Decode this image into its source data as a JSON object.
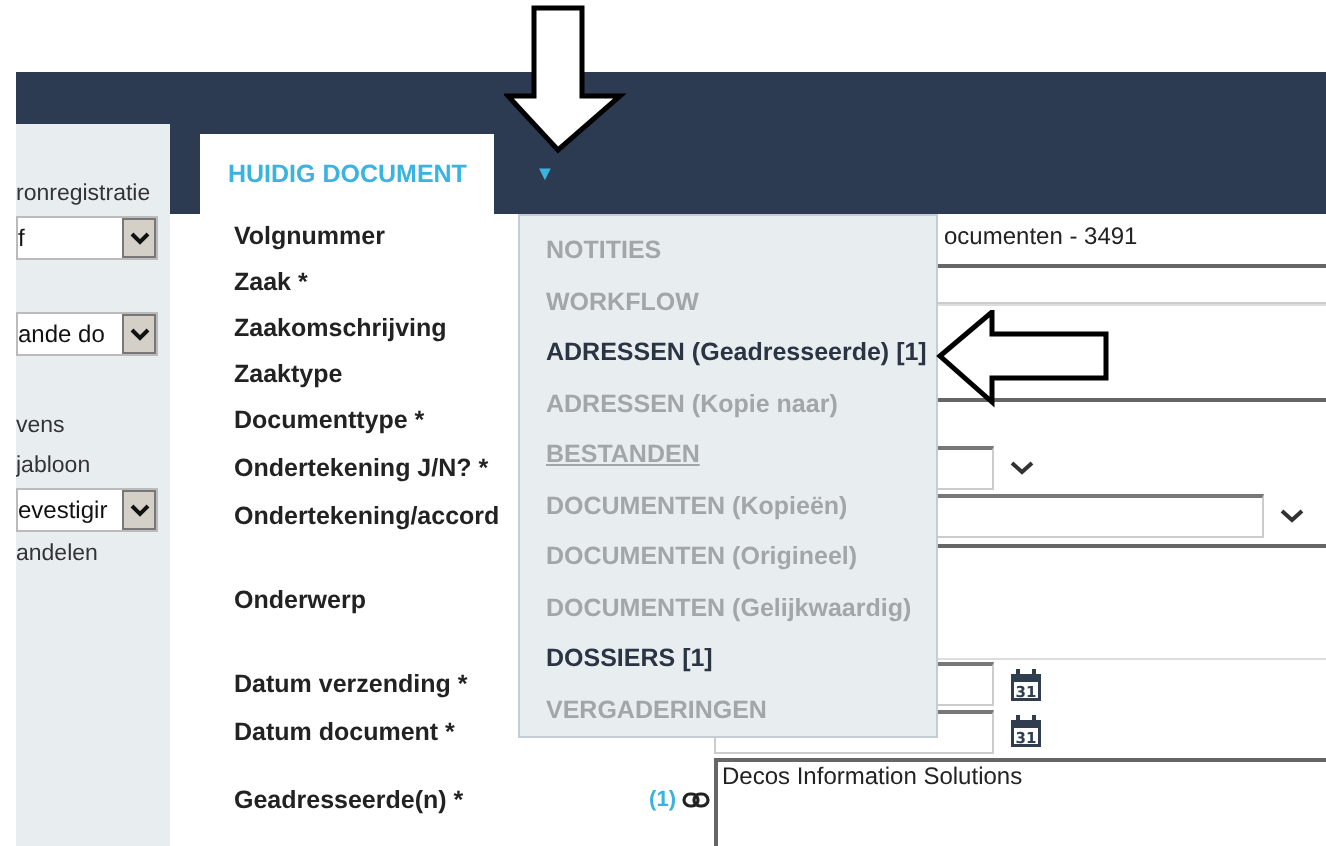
{
  "sidebar": {
    "items": [
      {
        "kind": "text",
        "text": "ronregistratie"
      },
      {
        "kind": "select",
        "value": "f"
      },
      {
        "kind": "gap"
      },
      {
        "kind": "select",
        "value": "ande do"
      },
      {
        "kind": "gap"
      },
      {
        "kind": "text",
        "text": "vens"
      },
      {
        "kind": "text",
        "text": "jabloon"
      },
      {
        "kind": "select",
        "value": "evestigir"
      },
      {
        "kind": "text",
        "text": "andelen"
      }
    ]
  },
  "tabs": [
    {
      "label": "HUIDIG DOCUMENT",
      "selected": true
    }
  ],
  "tab_menu_toggle": "▼",
  "form": {
    "fields": [
      {
        "label": "Volgnummer",
        "kind": "text",
        "value": "ocumenten - 3491"
      },
      {
        "label": "Zaak *",
        "kind": "input"
      },
      {
        "label": "Zaakomschrijving",
        "kind": "textarea"
      },
      {
        "label": "Zaaktype"
      },
      {
        "label": "Documenttype *"
      },
      {
        "label": "Ondertekening J/N? *",
        "kind": "select-short"
      },
      {
        "label": "Ondertekening/accord",
        "kind": "select-long"
      },
      {
        "label": "Onderwerp",
        "kind": "textarea-tall"
      },
      {
        "label": "Datum verzending *",
        "kind": "date",
        "calendar_day": "31"
      },
      {
        "label": "Datum document *",
        "kind": "date",
        "calendar_day": "31"
      },
      {
        "label": "Geadresseerde(n) *",
        "kind": "addressee",
        "count": "(1)",
        "value": "Decos Information Solutions"
      }
    ]
  },
  "dropdown_menu": {
    "items": [
      {
        "label": "NOTITIES",
        "disabled": true,
        "underlined": false
      },
      {
        "label": "WORKFLOW",
        "disabled": true,
        "underlined": false
      },
      {
        "label": "ADRESSEN (Geadresseerde) [1]",
        "disabled": false,
        "underlined": false
      },
      {
        "label": "ADRESSEN (Kopie naar)",
        "disabled": true,
        "underlined": false
      },
      {
        "label": "BESTANDEN",
        "disabled": true,
        "underlined": true
      },
      {
        "label": "DOCUMENTEN (Kopieën)",
        "disabled": true,
        "underlined": false
      },
      {
        "label": "DOCUMENTEN (Origineel)",
        "disabled": true,
        "underlined": false
      },
      {
        "label": "DOCUMENTEN (Gelijkwaardig)",
        "disabled": true,
        "underlined": false
      },
      {
        "label": "DOSSIERS [1]",
        "disabled": false,
        "underlined": false
      },
      {
        "label": "VERGADERINGEN",
        "disabled": true,
        "underlined": false
      }
    ]
  }
}
